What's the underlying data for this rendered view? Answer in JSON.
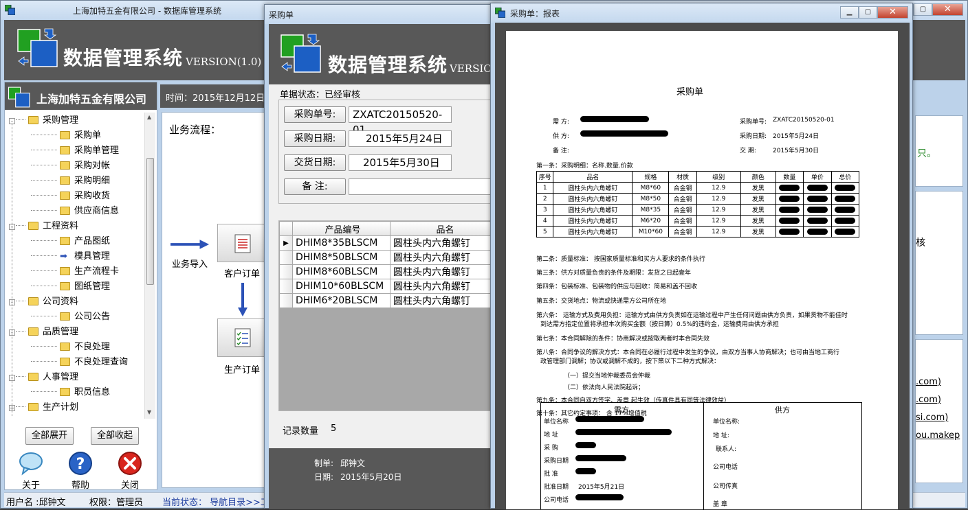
{
  "main_window": {
    "title": "上海加特五金有限公司 - 数据库管理系统",
    "banner_title": "数据管理系统",
    "banner_version": "VERSION(1.0)",
    "company_name": "上海加特五金有限公司",
    "time_label": "时间：2015年12月12日",
    "workflow_label": "业务流程：",
    "flow_import": "业务导入",
    "flow_customer_order": "客户订单",
    "flow_production_order": "生产订单",
    "expand_all": "全部展开",
    "collapse_all": "全部收起",
    "about": "关于",
    "help": "帮助",
    "close": "关闭",
    "status_user": "用户名 :邱钟文",
    "status_role": "权限：管理员",
    "status_current": "当前状态： 导航目录>>工",
    "right_fragment_1": "只。",
    "right_fragment_2": "核",
    "links": [
      ".com)",
      ".com)",
      "si.com)",
      "ou.makep"
    ]
  },
  "tree": [
    {
      "label": "采购管理",
      "level": 0,
      "expander": "-"
    },
    {
      "label": "采购单",
      "level": 1
    },
    {
      "label": "采购单管理",
      "level": 1
    },
    {
      "label": "采购对帐",
      "level": 1
    },
    {
      "label": "采购明细",
      "level": 1
    },
    {
      "label": "采购收货",
      "level": 1
    },
    {
      "label": "供应商信息",
      "level": 1
    },
    {
      "label": "工程资料",
      "level": 0,
      "expander": "-"
    },
    {
      "label": "产品图纸",
      "level": 1
    },
    {
      "label": "模具管理",
      "level": 1,
      "arrow": true
    },
    {
      "label": "生产流程卡",
      "level": 1
    },
    {
      "label": "图纸管理",
      "level": 1
    },
    {
      "label": "公司资料",
      "level": 0,
      "expander": "-"
    },
    {
      "label": "公司公告",
      "level": 1
    },
    {
      "label": "品质管理",
      "level": 0,
      "expander": "-"
    },
    {
      "label": "不良处理",
      "level": 1
    },
    {
      "label": "不良处理查询",
      "level": 1
    },
    {
      "label": "人事管理",
      "level": 0,
      "expander": "-"
    },
    {
      "label": "职员信息",
      "level": 1
    },
    {
      "label": "生产计划",
      "level": 0,
      "expander": "+"
    }
  ],
  "po_window": {
    "title": "采购单",
    "banner_title": "数据管理系统",
    "banner_version": "VERSION",
    "status_label": "单据状态：已经审核",
    "po_no_label": "采购单号:",
    "po_no_value": "ZXATC20150520-01",
    "po_date_label": "采购日期:",
    "po_date_value": "2015年5月24日",
    "delivery_label": "交货日期:",
    "delivery_value": "2015年5月30日",
    "remark_label": "备 注:",
    "remark_value": "",
    "columns": [
      "产品编号",
      "品名"
    ],
    "rows": [
      [
        "DHIM8*35BLSCM",
        "圆柱头内六角螺钉"
      ],
      [
        "DHIM8*50BLSCM",
        "圆柱头内六角螺钉"
      ],
      [
        "DHIM8*60BLSCM",
        "圆柱头内六角螺钉"
      ],
      [
        "DHIM10*60BLSCM",
        "圆柱头内六角螺钉"
      ],
      [
        "DHIM6*20BLSCM",
        "圆柱头内六角螺钉"
      ]
    ],
    "record_count_label": "记录数量",
    "record_count_value": "5",
    "maker_label": "制单:",
    "maker_value": "邱钟文",
    "date_label": "日期:",
    "date_value": "2015年5月20日"
  },
  "report_window": {
    "title": "采购单：报表",
    "doc_title": "采购单",
    "buyer_label": "需    方:",
    "supplier_label": "供    方:",
    "remark_label": "备    注:",
    "po_no_label": "采购单号:",
    "po_no_value": "ZXATC20150520-01",
    "po_date_label": "采购日期:",
    "po_date_value": "2015年5月24日",
    "delivery_label": "交    期:",
    "delivery_value": "2015年5月30日",
    "clause1": "第一条：采购明细：名称.数量.价款",
    "table_headers": [
      "序号",
      "品名",
      "规格",
      "材质",
      "级别",
      "颜色",
      "数量",
      "单价",
      "总价"
    ],
    "table_rows": [
      [
        "1",
        "圆柱头内六角螺钉",
        "M8*60",
        "合金钢",
        "12.9",
        "发黑"
      ],
      [
        "2",
        "圆柱头内六角螺钉",
        "M8*50",
        "合金钢",
        "12.9",
        "发黑"
      ],
      [
        "3",
        "圆柱头内六角螺钉",
        "M8*35",
        "合金钢",
        "12.9",
        "发黑"
      ],
      [
        "4",
        "圆柱头内六角螺钉",
        "M6*20",
        "合金钢",
        "12.9",
        "发黑"
      ],
      [
        "5",
        "圆柱头内六角螺钉",
        "M10*60",
        "合金钢",
        "12.9",
        "发黑"
      ]
    ],
    "clauses": [
      "第二条：质量标准： 按国家质量标准和买方人要求的条件执行",
      "第三条：供方对质量负责的条件及期限：发货之日起壹年",
      "第四条：包装标准、包装物的供应与回收：简易和盖不回收",
      "第五条：交货地点：物流或快递需方公司所在地",
      "第六条：  运输方式及费用负担：运输方式由供方负责如在运输过程中产生任何问题由供方负责，如果货物不能佳时",
      "到达需方指定位置将承担本次购买金额（按日算）0.5%的违约金，运输费用由供方承担",
      "第七条：本合同解除的条件：协商解决或按取两者时本合同失效",
      "第八条：合同争议的解决方式：本合同在必履行过程中发生的争议，由双方当事人协商解决；也可由当地工商行",
      "政管理部门调解；协议或调解不成的，按下策以下二种方式解决：",
      "（一）提交当地仲裁委员会仲裁",
      "（二）依法向人民法院起诉；",
      "第九条：本合同自双方签字、盖章 起生效（传真件具有同等法律效益）",
      "第十条：其它约定事项： 含 17%增值税"
    ],
    "buyer_header": "需方",
    "supplier_header": "供方",
    "buyer_fields": [
      "单位名称",
      "地    址",
      "采    购",
      "采购日期",
      "批    准",
      "批准日期",
      "公司电话"
    ],
    "approve_date_value": "2015年5月21日",
    "supplier_fields": [
      "单位名称:",
      "地    址:",
      "联系人:",
      "公司电话",
      "公司传真",
      "盖    章"
    ]
  },
  "colors": {
    "banner": "#585858",
    "titlebar": "#c9dcf0",
    "link_blue": "#1f3fa0",
    "right_green": "#2e8b2e"
  }
}
